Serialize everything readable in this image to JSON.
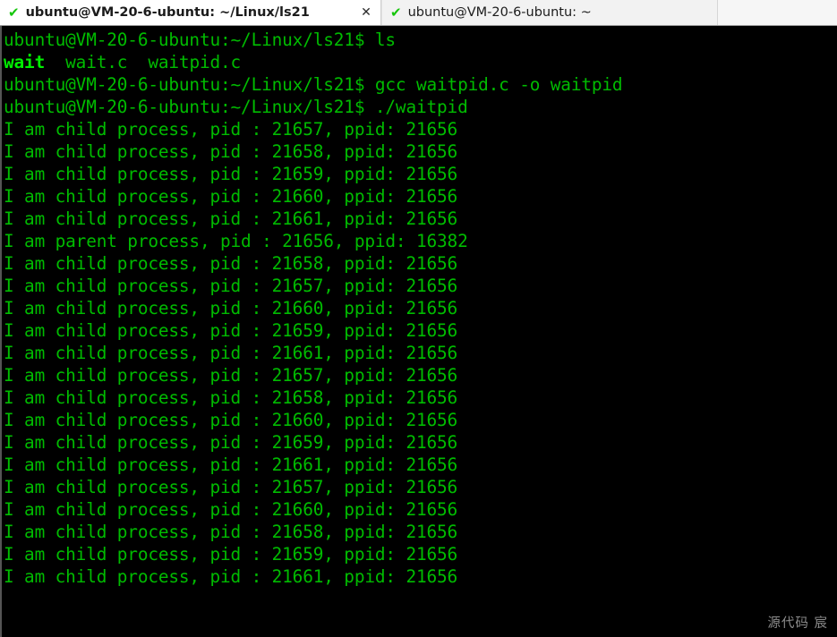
{
  "window": {
    "tabs": [
      {
        "check_icon": "✔",
        "title": "ubuntu@VM-20-6-ubuntu: ~/Linux/ls21",
        "close_icon": "✕",
        "active": true
      },
      {
        "check_icon": "✔",
        "title": "ubuntu@VM-20-6-ubuntu: ~",
        "close_icon": "",
        "active": false
      }
    ]
  },
  "terminal": {
    "prompt": "ubuntu@VM-20-6-ubuntu:~/Linux/ls21$ ",
    "lines": [
      {
        "type": "prompt",
        "command": "ls"
      },
      {
        "type": "ls-output",
        "entries": [
          "wait",
          "wait.c",
          "waitpid.c"
        ],
        "text": "wait  wait.c  waitpid.c"
      },
      {
        "type": "prompt",
        "command": "gcc waitpid.c -o waitpid"
      },
      {
        "type": "prompt",
        "command": "./waitpid"
      },
      {
        "type": "output",
        "text": "I am child process, pid : 21657, ppid: 21656"
      },
      {
        "type": "output",
        "text": "I am child process, pid : 21658, ppid: 21656"
      },
      {
        "type": "output",
        "text": "I am child process, pid : 21659, ppid: 21656"
      },
      {
        "type": "output",
        "text": "I am child process, pid : 21660, ppid: 21656"
      },
      {
        "type": "output",
        "text": "I am child process, pid : 21661, ppid: 21656"
      },
      {
        "type": "output",
        "text": "I am parent process, pid : 21656, ppid: 16382"
      },
      {
        "type": "output",
        "text": "I am child process, pid : 21658, ppid: 21656"
      },
      {
        "type": "output",
        "text": "I am child process, pid : 21657, ppid: 21656"
      },
      {
        "type": "output",
        "text": "I am child process, pid : 21660, ppid: 21656"
      },
      {
        "type": "output",
        "text": "I am child process, pid : 21659, ppid: 21656"
      },
      {
        "type": "output",
        "text": "I am child process, pid : 21661, ppid: 21656"
      },
      {
        "type": "output",
        "text": "I am child process, pid : 21657, ppid: 21656"
      },
      {
        "type": "output",
        "text": "I am child process, pid : 21658, ppid: 21656"
      },
      {
        "type": "output",
        "text": "I am child process, pid : 21660, ppid: 21656"
      },
      {
        "type": "output",
        "text": "I am child process, pid : 21659, ppid: 21656"
      },
      {
        "type": "output",
        "text": "I am child process, pid : 21661, ppid: 21656"
      },
      {
        "type": "output",
        "text": "I am child process, pid : 21657, ppid: 21656"
      },
      {
        "type": "output",
        "text": "I am child process, pid : 21660, ppid: 21656"
      },
      {
        "type": "output",
        "text": "I am child process, pid : 21658, ppid: 21656"
      },
      {
        "type": "output",
        "text": "I am child process, pid : 21659, ppid: 21656"
      },
      {
        "type": "output",
        "text": "I am child process, pid : 21661, ppid: 21656"
      }
    ]
  },
  "watermark": {
    "text": "源代码  宸"
  },
  "colors": {
    "background": "#000000",
    "text_green": "#00bb00",
    "bold_green": "#00ef00",
    "tab_active_bg": "#ffffff",
    "tab_inactive_bg": "#f2f2f2",
    "check_green": "#16c60c",
    "watermark_gray": "#8c8c8c"
  }
}
